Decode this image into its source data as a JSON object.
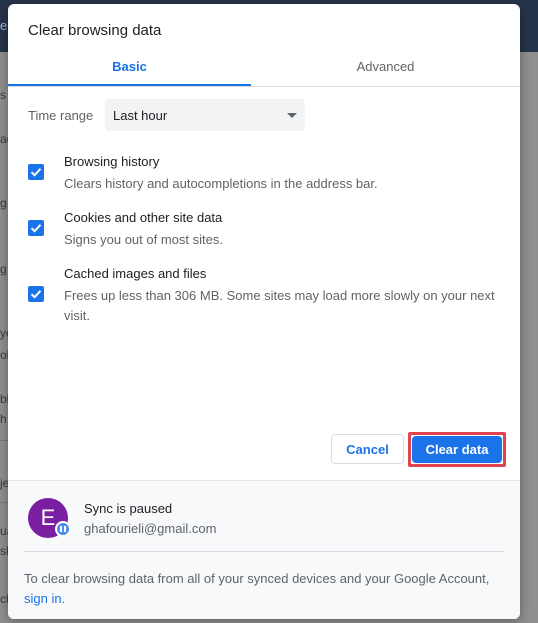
{
  "background": {
    "topbar_fragment": "e",
    "fragments": [
      "s",
      "ac",
      "g",
      "g",
      "ye",
      "ol",
      "bl",
      "h",
      "je",
      "ua",
      "sh",
      "cl"
    ]
  },
  "dialog": {
    "title": "Clear browsing data",
    "tabs": [
      {
        "label": "Basic",
        "active": true
      },
      {
        "label": "Advanced",
        "active": false
      }
    ],
    "time_range": {
      "label": "Time range",
      "value": "Last hour"
    },
    "options": [
      {
        "title": "Browsing history",
        "description": "Clears history and autocompletions in the address bar.",
        "checked": true
      },
      {
        "title": "Cookies and other site data",
        "description": "Signs you out of most sites.",
        "checked": true
      },
      {
        "title": "Cached images and files",
        "description": "Frees up less than 306 MB. Some sites may load more slowly on your next visit.",
        "checked": true
      }
    ],
    "buttons": {
      "cancel": "Cancel",
      "clear": "Clear data"
    },
    "account": {
      "avatar_letter": "E",
      "sync_status": "Sync is paused",
      "email": "ghafourieli@gmail.com"
    },
    "footer_note": {
      "text": "To clear browsing data from all of your synced devices and your Google Account,",
      "link": "sign in",
      "suffix": "."
    }
  },
  "colors": {
    "accent": "#1a73e8",
    "highlight_frame": "#e0454f",
    "avatar_bg": "#7b1fa2"
  }
}
